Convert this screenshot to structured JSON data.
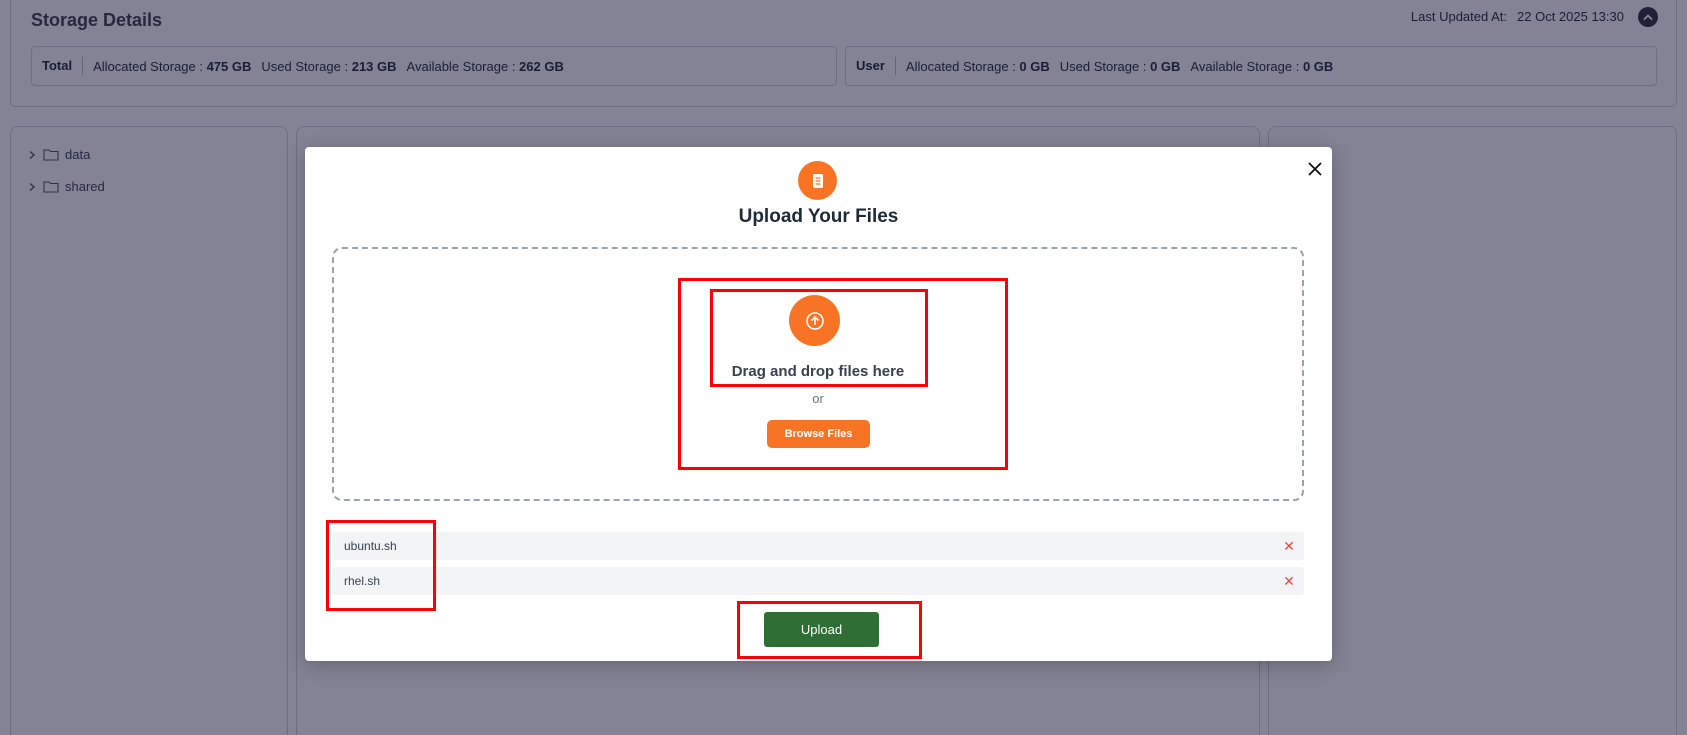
{
  "storage": {
    "title": "Storage Details",
    "last_updated_label": "Last Updated At:",
    "last_updated_value": "22 Oct 2025 13:30",
    "total": {
      "label": "Total",
      "allocated_label": "Allocated Storage",
      "allocated_value": "475 GB",
      "used_label": "Used Storage",
      "used_value": "213 GB",
      "available_label": "Available Storage",
      "available_value": "262 GB"
    },
    "user": {
      "label": "User",
      "allocated_label": "Allocated Storage",
      "allocated_value": "0 GB",
      "used_label": "Used Storage",
      "used_value": "0 GB",
      "available_label": "Available Storage",
      "available_value": "0 GB"
    }
  },
  "tree": {
    "items": [
      {
        "label": "data"
      },
      {
        "label": "shared"
      }
    ]
  },
  "modal": {
    "title": "Upload Your Files",
    "drag_text": "Drag and drop files here",
    "or_text": "or",
    "browse_label": "Browse Files",
    "files": [
      {
        "name": "ubuntu.sh"
      },
      {
        "name": "rhel.sh"
      }
    ],
    "upload_label": "Upload"
  },
  "colors": {
    "accent": "#f97324",
    "upload_button": "#2f6f35",
    "highlight": "#ff0000",
    "remove": "#ef4444"
  }
}
